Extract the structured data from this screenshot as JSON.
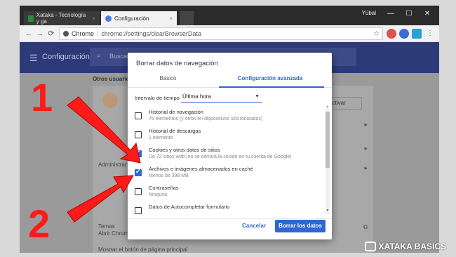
{
  "window": {
    "user": "Yúbal",
    "tabs": [
      {
        "title": "Xataka - Tecnología y ga",
        "close": "×"
      },
      {
        "title": "Configuración",
        "close": "×"
      }
    ],
    "controls": {
      "minimize": "—",
      "maximize": "☐",
      "close": "✕"
    }
  },
  "toolbar": {
    "back": "←",
    "forward": "→",
    "reload": "⟳",
    "scheme": "Chrome",
    "url": "chrome://settings/clearBrowserData",
    "star": "☆"
  },
  "settings": {
    "title": "Configuración",
    "search_placeholder": "Buscar ajustes",
    "section_people": "Otros usuarios",
    "activate_button": "activar",
    "admin_label": "Administrar",
    "themes_label": "Temas",
    "themes_sub": "Abrir Chrome",
    "home_button_label": "Mostrar el botón de página principal"
  },
  "dialog": {
    "title": "Borrar datos de navegación",
    "tabs": {
      "basic": "Básico",
      "advanced": "Configuración avanzada"
    },
    "interval_label": "Intervalo de tiempo",
    "interval_value": "Última hora",
    "items": [
      {
        "title": "Historial de navegación",
        "sub": "76 elementos (y otros en dispositivos sincronizados)",
        "checked": false
      },
      {
        "title": "Historial de descargas",
        "sub": "1 elemento",
        "checked": false
      },
      {
        "title": "Cookies y otros datos de sitios",
        "sub": "De 72 sitios web (no se cerrará la sesión en tu cuenta de Google)",
        "checked": true
      },
      {
        "title": "Archivos e imágenes almacenados en caché",
        "sub": "Menos de 398 MB",
        "checked": true
      },
      {
        "title": "Contraseñas",
        "sub": "Ninguna",
        "checked": false
      },
      {
        "title": "Datos de Autocompletar formulario",
        "sub": "",
        "checked": false
      }
    ],
    "cancel": "Cancelar",
    "clear": "Borrar los datos"
  },
  "annotations": {
    "one": "1",
    "two": "2",
    "color": "#ff1a1a"
  },
  "watermark": {
    "text": "XATAKA BASICS"
  },
  "colors": {
    "accent": "#2e66d4",
    "appbar": "#2c3b78"
  }
}
